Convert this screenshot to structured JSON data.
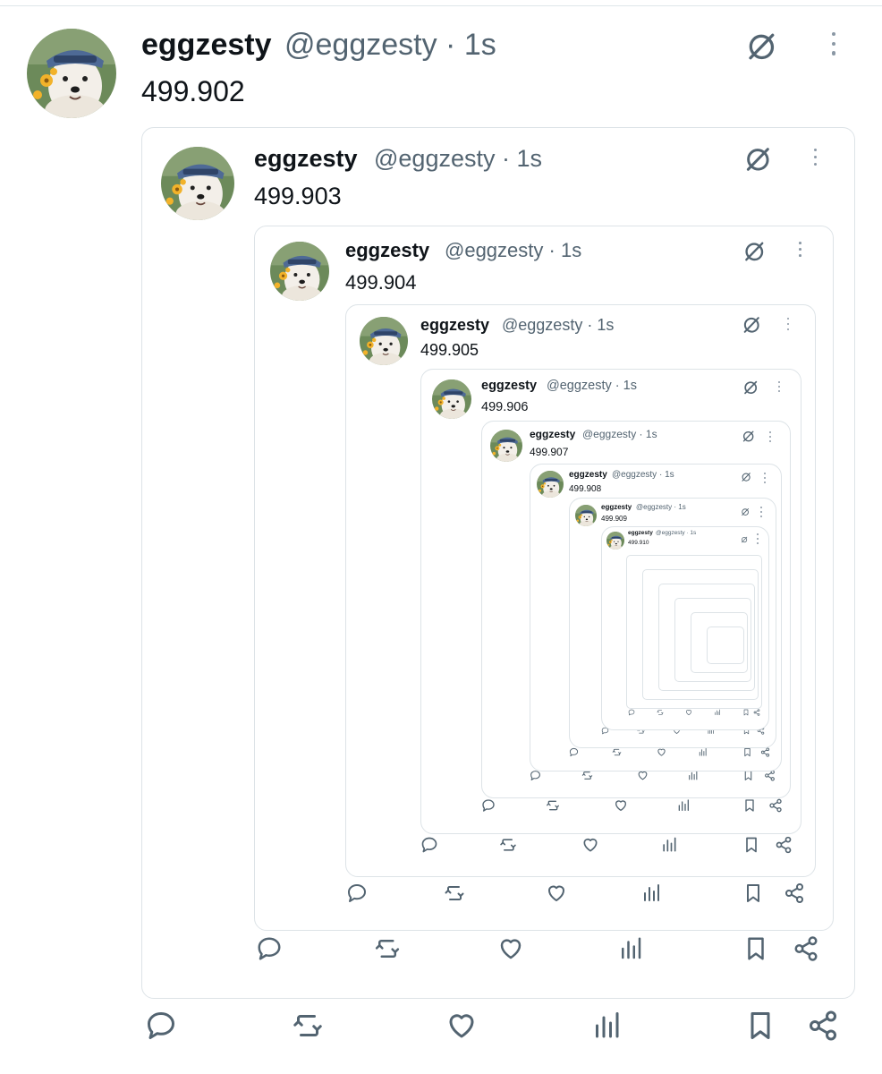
{
  "author": {
    "display_name": "eggzesty",
    "handle": "@eggzesty",
    "time_sep": " · ",
    "time": "1s"
  },
  "posts": [
    {
      "text": "499.902"
    },
    {
      "text": "499.903"
    },
    {
      "text": "499.904"
    },
    {
      "text": "499.905"
    },
    {
      "text": "499.906"
    },
    {
      "text": "499.907"
    },
    {
      "text": "499.908"
    },
    {
      "text": "499.909"
    },
    {
      "text": "499.910"
    }
  ],
  "icons": {
    "menu": "grok-icon",
    "more": "more-vertical-icon",
    "reply": "reply-icon",
    "repost": "repost-icon",
    "like": "like-icon",
    "views": "views-icon",
    "bookmark": "bookmark-icon",
    "share": "share-icon"
  },
  "colors": {
    "text": "#0f1419",
    "secondary": "#536471",
    "border": "#dde3e7",
    "icon": "#536471"
  }
}
